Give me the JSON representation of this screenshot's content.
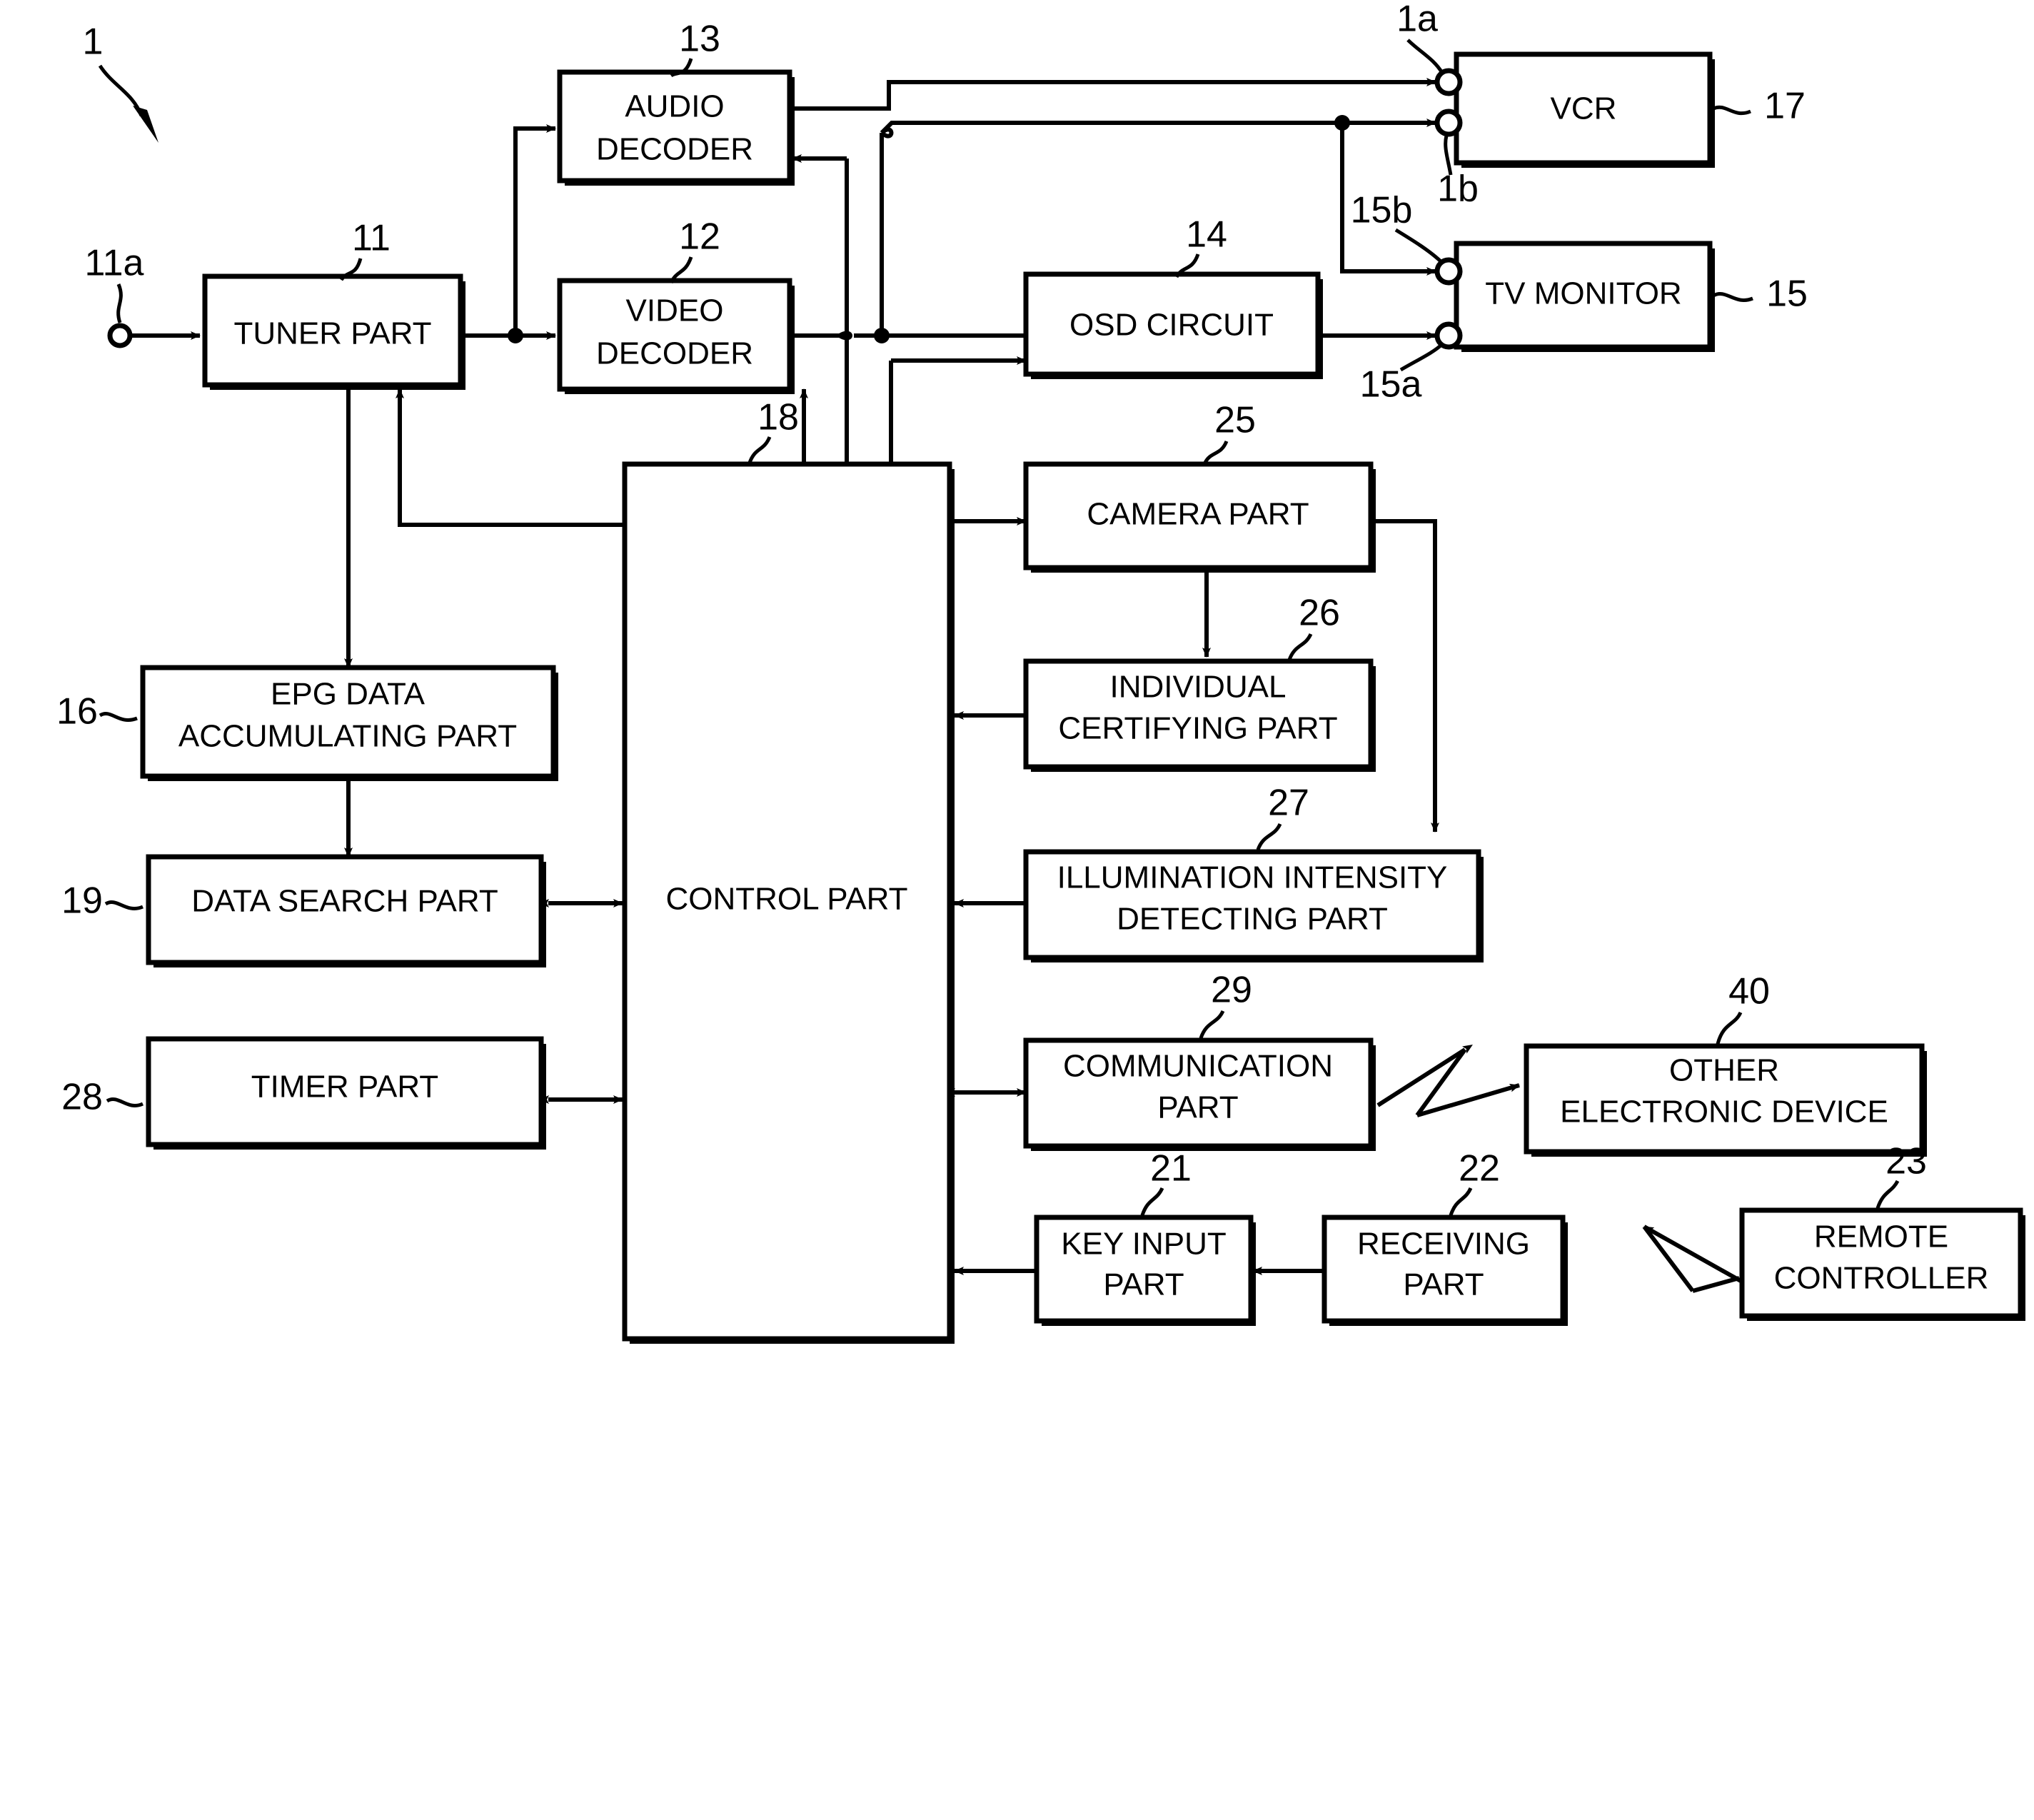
{
  "figure": {
    "title_ref": "1",
    "blocks": [
      {
        "id": "tuner",
        "ref": "11",
        "label": [
          "TUNER PART"
        ]
      },
      {
        "id": "audio",
        "ref": "13",
        "label": [
          "AUDIO",
          "DECODER"
        ]
      },
      {
        "id": "video",
        "ref": "12",
        "label": [
          "VIDEO",
          "DECODER"
        ]
      },
      {
        "id": "osd",
        "ref": "14",
        "label": [
          "OSD CIRCUIT"
        ]
      },
      {
        "id": "vcr",
        "ref": "17",
        "label": [
          "VCR"
        ]
      },
      {
        "id": "tv",
        "ref": "15",
        "label": [
          "TV MONITOR"
        ]
      },
      {
        "id": "control",
        "ref": "18",
        "label": [
          "CONTROL PART"
        ]
      },
      {
        "id": "camera",
        "ref": "25",
        "label": [
          "CAMERA PART"
        ]
      },
      {
        "id": "certify",
        "ref": "26",
        "label": [
          "INDIVIDUAL",
          "CERTIFYING PART"
        ]
      },
      {
        "id": "illum",
        "ref": "27",
        "label": [
          "ILLUMINATION INTENSITY",
          "DETECTING PART"
        ]
      },
      {
        "id": "epg",
        "ref": "16",
        "label": [
          "EPG DATA",
          "ACCUMULATING PART"
        ]
      },
      {
        "id": "search",
        "ref": "19",
        "label": [
          "DATA SEARCH PART"
        ]
      },
      {
        "id": "timer",
        "ref": "28",
        "label": [
          "TIMER PART"
        ]
      },
      {
        "id": "comm",
        "ref": "29",
        "label": [
          "COMMUNICATION",
          "PART"
        ]
      },
      {
        "id": "other",
        "ref": "40",
        "label": [
          "OTHER",
          "ELECTRONIC DEVICE"
        ]
      },
      {
        "id": "keyinput",
        "ref": "21",
        "label": [
          "KEY INPUT",
          "PART"
        ]
      },
      {
        "id": "receiving",
        "ref": "22",
        "label": [
          "RECEIVING",
          "PART"
        ]
      },
      {
        "id": "remote",
        "ref": "23",
        "label": [
          "REMOTE",
          "CONTROLLER"
        ]
      }
    ],
    "terminals": [
      {
        "id": "antenna-in",
        "ref": "11a"
      },
      {
        "id": "vcr-in-1",
        "ref": "1a"
      },
      {
        "id": "vcr-in-2",
        "ref": "1b"
      },
      {
        "id": "tv-in-1",
        "ref": "15b"
      },
      {
        "id": "tv-in-2",
        "ref": "15a"
      }
    ],
    "colors": {
      "line": "#000000",
      "fill": "#ffffff"
    }
  }
}
